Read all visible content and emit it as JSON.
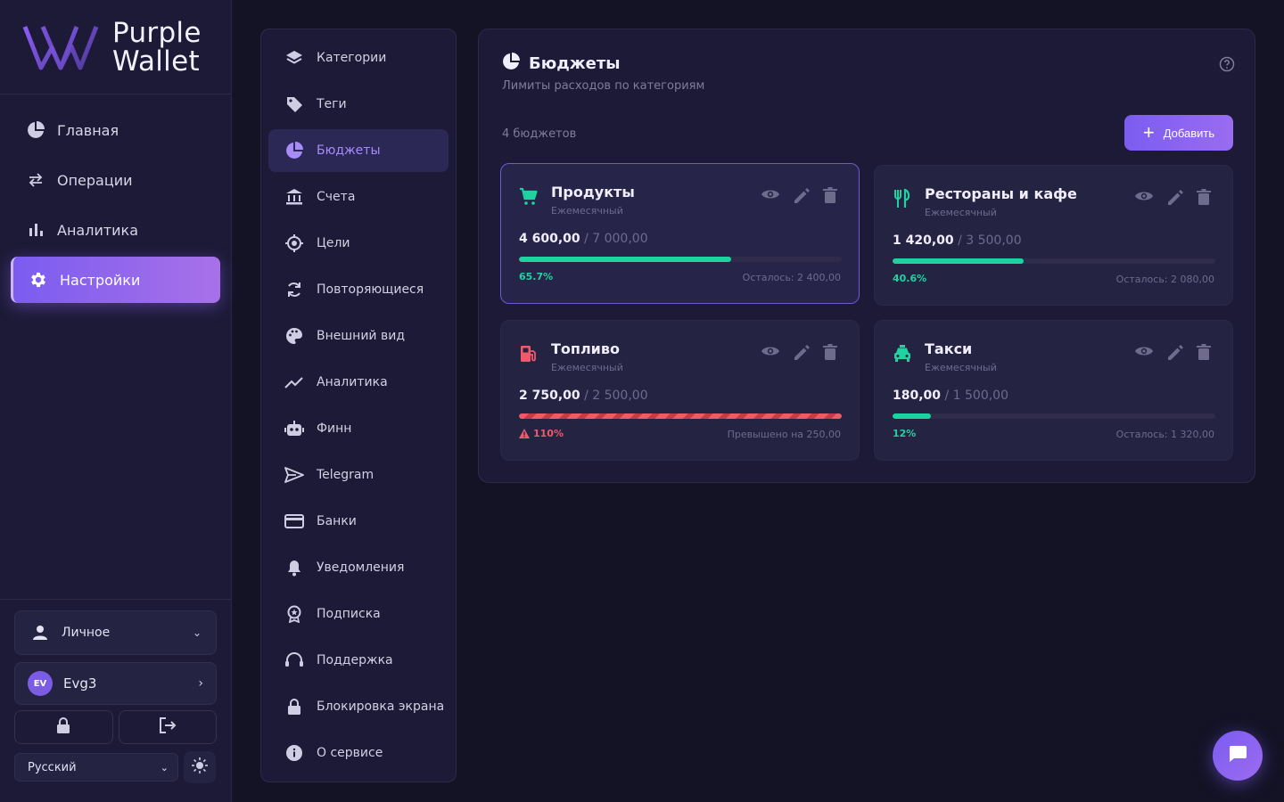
{
  "app": {
    "name_line1": "Purple",
    "name_line2": "Wallet"
  },
  "nav": {
    "items": [
      {
        "label": "Главная",
        "icon": "pie-chart-icon"
      },
      {
        "label": "Операции",
        "icon": "transfer-arrows-icon"
      },
      {
        "label": "Аналитика",
        "icon": "bar-chart-icon"
      },
      {
        "label": "Настройки",
        "icon": "gear-icon",
        "active": true
      }
    ]
  },
  "sidebar_bottom": {
    "profile_label": "Личное",
    "user_initials": "EV",
    "user_name": "Evg3",
    "language": "Русский"
  },
  "settings_menu": {
    "items": [
      {
        "label": "Категории",
        "icon": "layers-icon"
      },
      {
        "label": "Теги",
        "icon": "tag-icon"
      },
      {
        "label": "Бюджеты",
        "icon": "pie-chart-icon",
        "active": true
      },
      {
        "label": "Счета",
        "icon": "bank-icon"
      },
      {
        "label": "Цели",
        "icon": "target-icon"
      },
      {
        "label": "Повторяющиеся",
        "icon": "repeat-icon"
      },
      {
        "label": "Внешний вид",
        "icon": "palette-icon"
      },
      {
        "label": "Аналитика",
        "icon": "trend-line-icon"
      },
      {
        "label": "Финн",
        "icon": "robot-icon"
      },
      {
        "label": "Telegram",
        "icon": "send-icon"
      },
      {
        "label": "Банки",
        "icon": "credit-card-icon"
      },
      {
        "label": "Уведомления",
        "icon": "bell-icon"
      },
      {
        "label": "Подписка",
        "icon": "badge-icon"
      },
      {
        "label": "Поддержка",
        "icon": "headset-icon"
      },
      {
        "label": "Блокировка экрана",
        "icon": "lock-icon"
      },
      {
        "label": "О сервисе",
        "icon": "info-icon"
      }
    ]
  },
  "budgets": {
    "title": "Бюджеты",
    "subtitle": "Лимиты расходов по категориям",
    "count_label": "4 бюджетов",
    "add_label": "Добавить",
    "colors": {
      "accent": "#7b5cf0",
      "ok": "#1fd3a0",
      "over": "#ef5a6a"
    },
    "cards": [
      {
        "name": "Продукты",
        "period": "Ежемесячный",
        "spent": "4 600,00",
        "limit": "/ 7 000,00",
        "percent_label": "65.7%",
        "progress": 0.657,
        "rest": "Осталось: 2 400,00",
        "icon": "cart-icon",
        "icon_color": "#1fd3a0",
        "over": false,
        "selected": true
      },
      {
        "name": "Рестораны и кафе",
        "period": "Ежемесячный",
        "spent": "1 420,00",
        "limit": "/ 3 500,00",
        "percent_label": "40.6%",
        "progress": 0.406,
        "rest": "Осталось: 2 080,00",
        "icon": "cutlery-icon",
        "icon_color": "#1fd3a0",
        "over": false,
        "selected": false
      },
      {
        "name": "Топливо",
        "period": "Ежемесячный",
        "spent": "2 750,00",
        "limit": "/ 2 500,00",
        "percent_label": "110%",
        "progress": 1.0,
        "rest": "Превышено на 250,00",
        "icon": "fuel-icon",
        "icon_color": "#ef5a6a",
        "over": true,
        "selected": false
      },
      {
        "name": "Такси",
        "period": "Ежемесячный",
        "spent": "180,00",
        "limit": "/ 1 500,00",
        "percent_label": "12%",
        "progress": 0.12,
        "rest": "Осталось: 1 320,00",
        "icon": "taxi-icon",
        "icon_color": "#1fd3a0",
        "over": false,
        "selected": false
      }
    ]
  }
}
